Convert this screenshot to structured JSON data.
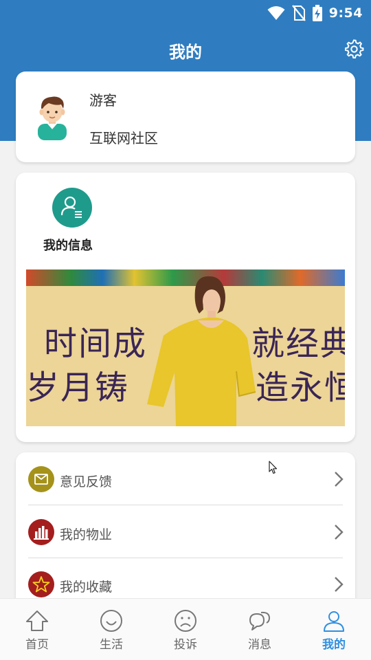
{
  "status_bar": {
    "time": "9:54"
  },
  "header": {
    "title": "我的"
  },
  "profile": {
    "user_name": "游客",
    "community": "互联网社区"
  },
  "my_info": {
    "label": "我的信息"
  },
  "banner": {
    "line1_left": "时间成",
    "line2_left": "岁月铸",
    "line1_right": "就经典",
    "line2_right": "造永恒"
  },
  "menu": {
    "items": [
      {
        "label": "意见反馈",
        "icon": "feedback-icon",
        "color": "#a5921a"
      },
      {
        "label": "我的物业",
        "icon": "property-icon",
        "color": "#a41e1e"
      },
      {
        "label": "我的收藏",
        "icon": "star-icon",
        "color": "#a41e1e"
      }
    ]
  },
  "bottom_nav": {
    "items": [
      {
        "label": "首页",
        "icon": "home-icon"
      },
      {
        "label": "生活",
        "icon": "smile-icon"
      },
      {
        "label": "投诉",
        "icon": "sad-face-icon"
      },
      {
        "label": "消息",
        "icon": "chat-icon"
      },
      {
        "label": "我的",
        "icon": "user-icon",
        "active": true
      }
    ]
  },
  "colors": {
    "primary": "#2f7dc0",
    "active_tab": "#2f8fe0",
    "info_icon": "#1f9b8c"
  }
}
